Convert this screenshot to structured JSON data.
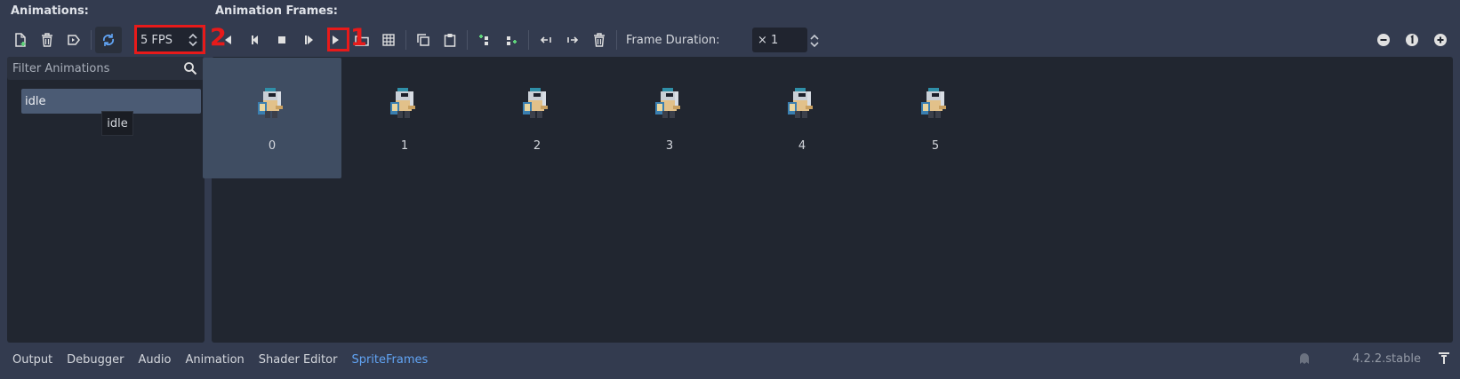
{
  "headers": {
    "animations": "Animations:",
    "frames": "Animation Frames:"
  },
  "fps": {
    "value": "5 FPS"
  },
  "annotations": {
    "one": "1",
    "two": "2"
  },
  "filter": {
    "placeholder": "Filter Animations"
  },
  "animations": [
    {
      "name": "idle"
    }
  ],
  "tooltip": "idle",
  "frame_duration": {
    "label": "Frame Duration:",
    "value": "× 1"
  },
  "frames": [
    {
      "index": "0",
      "selected": true
    },
    {
      "index": "1"
    },
    {
      "index": "2"
    },
    {
      "index": "3"
    },
    {
      "index": "4"
    },
    {
      "index": "5"
    }
  ],
  "bottom_tabs": [
    "Output",
    "Debugger",
    "Audio",
    "Animation",
    "Shader Editor",
    "SpriteFrames"
  ],
  "active_tab": "SpriteFrames",
  "version": "4.2.2.stable",
  "colors": {
    "accent": "#61a4f4",
    "annotation_red": "#e81a1a",
    "selected": "#3f4d62",
    "panel": "#212630",
    "bg": "#333b4f"
  }
}
